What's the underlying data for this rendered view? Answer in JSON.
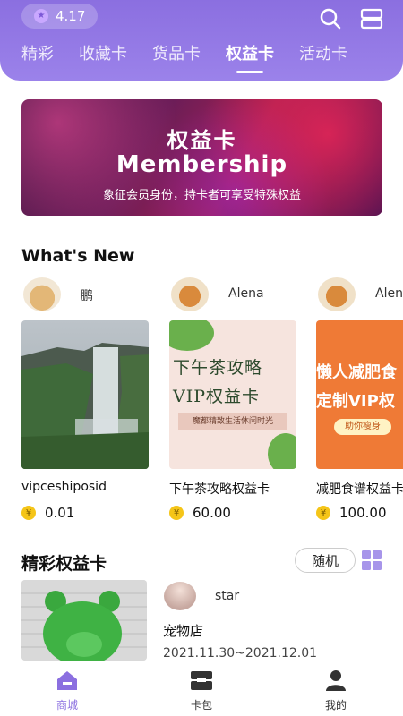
{
  "header": {
    "balance": "4.17",
    "tabs": [
      {
        "label": "精彩",
        "active": false
      },
      {
        "label": "收藏卡",
        "active": false
      },
      {
        "label": "货品卡",
        "active": false
      },
      {
        "label": "权益卡",
        "active": true
      },
      {
        "label": "活动卡",
        "active": false
      }
    ],
    "icons": [
      "search-icon",
      "menu-icon"
    ]
  },
  "banner": {
    "title": "权益卡",
    "subtitle": "Membership",
    "description": "象征会员身份，持卡者可享受特殊权益"
  },
  "whats_new": {
    "heading": "What's New",
    "cards": [
      {
        "author": "鹏",
        "title": "vipceshiposid",
        "price": "0.01"
      },
      {
        "author": "Alena",
        "title": "下午茶攻略权益卡",
        "price": "60.00",
        "thumb_text": [
          "下午茶攻略",
          "VIP权益卡",
          "魔都精致生活休闲时光"
        ]
      },
      {
        "author": "Alen",
        "title": "减肥食谱权益卡",
        "price": "100.00",
        "thumb_text": [
          "懒人减肥食",
          "定制VIP权",
          "助你瘦身"
        ]
      }
    ]
  },
  "featured": {
    "heading": "精彩权益卡",
    "random_label": "随机",
    "item": {
      "author": "star",
      "title": "宠物店",
      "date": "2021.11.30~2021.12.01"
    }
  },
  "bottom_nav": [
    {
      "label": "商城",
      "active": true
    },
    {
      "label": "卡包",
      "active": false
    },
    {
      "label": "我的",
      "active": false
    }
  ],
  "colors": {
    "accent": "#8b6fe0",
    "coin": "#f5c518"
  }
}
